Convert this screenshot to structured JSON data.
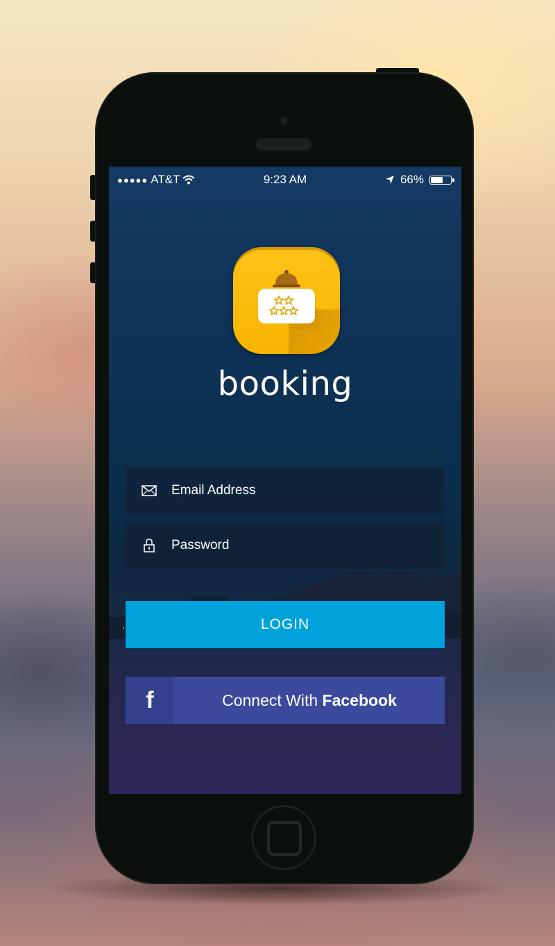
{
  "status_bar": {
    "carrier": "AT&T",
    "time": "9:23 AM",
    "battery_percent": "66%",
    "battery_level": 0.66
  },
  "app": {
    "brand_name": "booking",
    "icon": "hotel-service-bell-icon",
    "accent_color": "#ffc21a"
  },
  "form": {
    "email_placeholder": "Email Address",
    "password_placeholder": "Password",
    "login_label": "LOGIN",
    "facebook_prefix": "Connect With",
    "facebook_brand": "Facebook"
  },
  "colors": {
    "login_button": "#00a2dc",
    "facebook_button": "#3c4a9d"
  }
}
